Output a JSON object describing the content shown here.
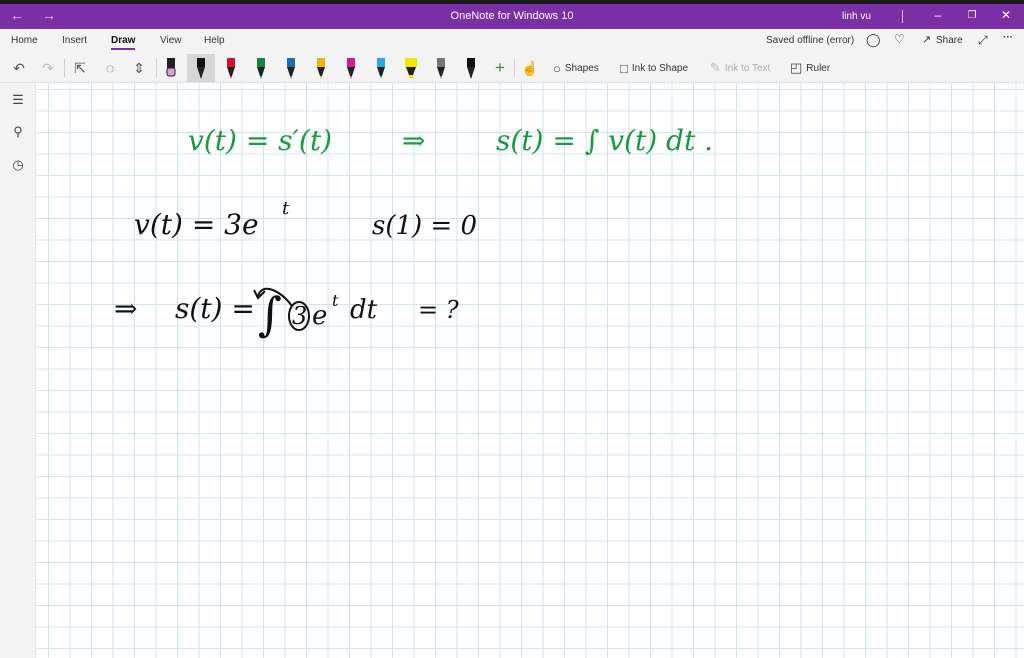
{
  "window": {
    "title": "OneNote for Windows 10",
    "user": "linh vu",
    "back_glyph": "←",
    "forward_glyph": "→",
    "min_glyph": "–",
    "restore_glyph": "❐",
    "close_glyph": "✕"
  },
  "ribbon": {
    "tabs": [
      "Home",
      "Insert",
      "Draw",
      "View",
      "Help"
    ],
    "active_tab": "Draw",
    "status": "Saved offline (error)",
    "share_label": "Share",
    "more_glyph": "···"
  },
  "toolbar": {
    "pens": [
      {
        "color": "#111111",
        "tip": "#d9a0d9",
        "kind": "eraser"
      },
      {
        "color": "#111111",
        "kind": "pen"
      },
      {
        "color": "#d2142b",
        "kind": "pen"
      },
      {
        "color": "#0f8a3c",
        "kind": "pen"
      },
      {
        "color": "#1b6bb8",
        "kind": "pen"
      },
      {
        "color": "#f2b200",
        "kind": "pen"
      },
      {
        "color": "#cc1f8a",
        "kind": "pen"
      },
      {
        "color": "#2aa9e0",
        "kind": "pen"
      },
      {
        "color": "#f4e400",
        "kind": "highlighter"
      },
      {
        "color": "#777777",
        "kind": "pen"
      },
      {
        "color": "#111111",
        "kind": "pen"
      }
    ],
    "add_pen_glyph": "+",
    "shapes_label": "Shapes",
    "ink_to_shape_label": "Ink to Shape",
    "ink_to_text_label": "Ink to Text",
    "ruler_label": "Ruler"
  },
  "colors": {
    "accent": "#7b2fa6",
    "ink_green": "#1a9940",
    "ink_black": "#111111",
    "grid": "#cfe3ef"
  },
  "notes": {
    "line1_left": "v(t) = s′(t)",
    "line1_arrow": "⇒",
    "line1_right": "s(t) = ∫ v(t) dt .",
    "line2_left": "v(t) = 3e",
    "line2_exp": "t",
    "line2_right": "s(1) = 0",
    "line3_arrow": "⇒",
    "line3_left": "s(t) = ",
    "line3_integral": "∫",
    "line3_coef": "3",
    "line3_body": "e",
    "line3_exp": "t",
    "line3_dt": "dt",
    "line3_eq": "= ?"
  }
}
